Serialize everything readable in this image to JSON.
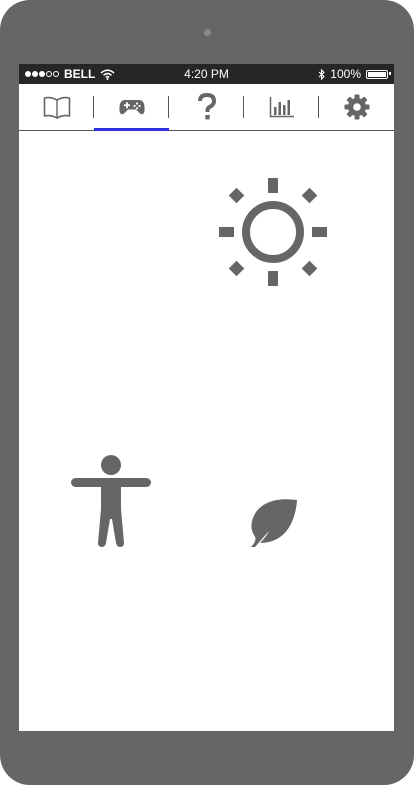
{
  "device": {
    "frame_color": "#666666"
  },
  "status_bar": {
    "signal_strength": 3,
    "signal_total": 5,
    "carrier": "BELL",
    "time": "4:20 PM",
    "battery_percent": "100%",
    "battery_level": 1.0,
    "bluetooth_icon": "bluetooth-icon",
    "wifi_icon": "wifi-icon"
  },
  "tabs": [
    {
      "icon": "book-icon",
      "active": false
    },
    {
      "icon": "gamepad-icon",
      "active": true
    },
    {
      "icon": "question-mark-icon",
      "active": false
    },
    {
      "icon": "bar-chart-icon",
      "active": false
    },
    {
      "icon": "gear-icon",
      "active": false
    }
  ],
  "colors": {
    "icon_gray": "#666666",
    "active_tab_underline": "#3030e0",
    "status_bar_bg": "#262626"
  },
  "content_icons": [
    "sun-icon",
    "person-icon",
    "leaf-icon"
  ]
}
